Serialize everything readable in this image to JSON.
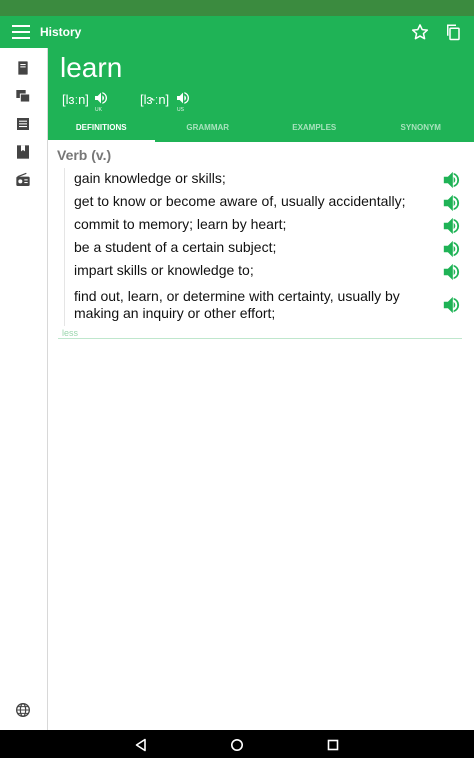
{
  "app_bar": {
    "title": "History"
  },
  "entry": {
    "word": "learn",
    "pronunciations": [
      {
        "ipa": "[lɜːn]",
        "region": "UK"
      },
      {
        "ipa": "[lɝːn]",
        "region": "US"
      }
    ]
  },
  "tabs": [
    {
      "label": "DEFINITIONS",
      "active": true
    },
    {
      "label": "GRAMMAR",
      "active": false
    },
    {
      "label": "EXAMPLES",
      "active": false
    },
    {
      "label": "SYNONYM",
      "active": false
    }
  ],
  "definitions": {
    "pos": "Verb (v.)",
    "items": [
      "gain knowledge or skills;",
      "get to know or become aware of, usually accidentally;",
      "commit to memory; learn by heart;",
      "be a student of a certain subject;",
      "impart skills or knowledge to;",
      "find out, learn, or determine with certainty, usually by making an inquiry or other effort;"
    ],
    "less_label": "less"
  },
  "colors": {
    "accent": "#1fb356",
    "status_bar": "#3b8b3f",
    "speaker": "#1fb356"
  },
  "icons": {
    "sidebar": [
      "book-icon",
      "flashcards-icon",
      "list-icon",
      "bookmark-icon",
      "radio-icon",
      "globe-icon"
    ],
    "actions": [
      "star-icon",
      "copy-icon"
    ],
    "nav": [
      "back-icon",
      "home-icon",
      "recents-icon"
    ]
  }
}
